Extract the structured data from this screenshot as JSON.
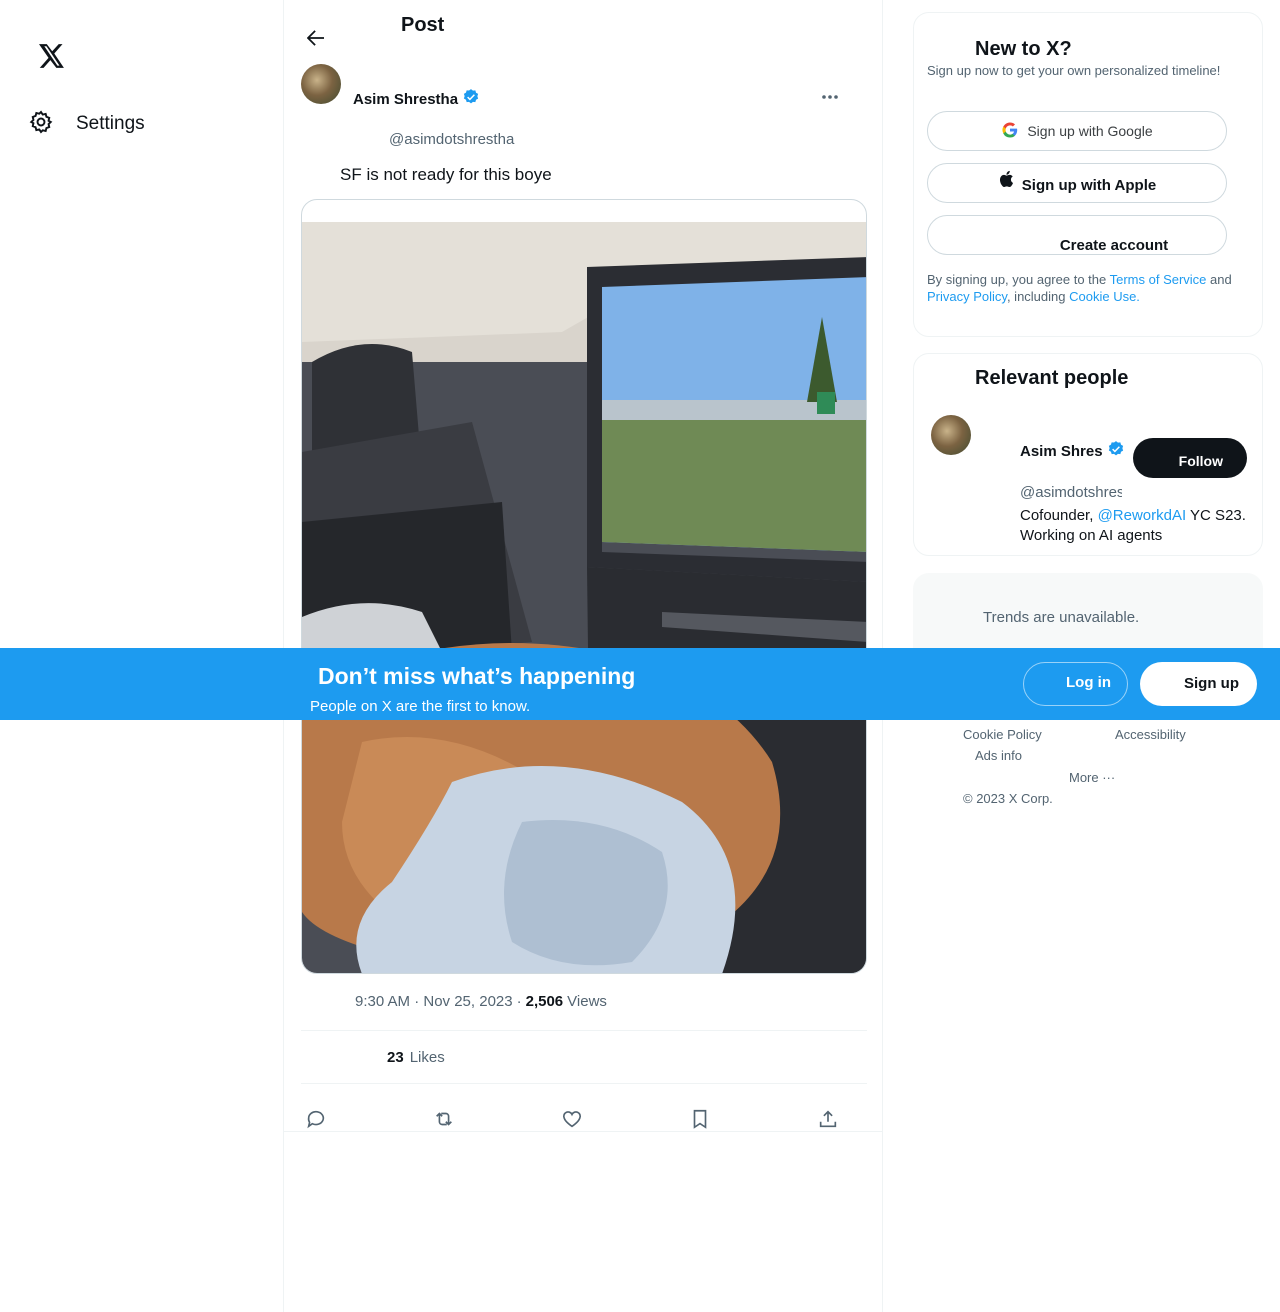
{
  "nav": {
    "logo_icon": "x-logo-icon",
    "settings_label": "Settings"
  },
  "header": {
    "title": "Post"
  },
  "post": {
    "author_name": "Asim Shrestha",
    "author_handle": "@asimdotshrestha",
    "text": "SF is not ready for this boye",
    "time": "9:30 AM · Nov 25, 2023",
    "separator": "·",
    "views_count": "2,506",
    "views_label": "Views",
    "likes_count": "23",
    "likes_label": "Likes"
  },
  "sidebar": {
    "new_title": "New to X?",
    "new_sub": "Sign up now to get your own personalized timeline!",
    "google_label": "Sign up with Google",
    "apple_label": "Sign up with Apple",
    "create_label": "Create account",
    "legal_prefix": "By signing up, you agree to the ",
    "terms": "Terms of Service",
    "and": " and ",
    "privacy": "Privacy Policy",
    "including": ", including ",
    "cookie_use": "Cookie Use.",
    "relevant_title": "Relevant people",
    "rel_name": "Asim Shres",
    "rel_handle": "@asimdotshrestha",
    "follow_label": "Follow",
    "bio_prefix": "Cofounder, ",
    "bio_link": "@ReworkdAI",
    "bio_rest": " YC S23. Working on AI agents",
    "trends_text": "Trends are unavailable.",
    "footer": {
      "cookie_policy": "Cookie Policy",
      "accessibility": "Accessibility",
      "ads_info": "Ads info",
      "more": "More ···",
      "copyright": "© 2023 X Corp."
    }
  },
  "banner": {
    "title": "Don’t miss what’s happening",
    "subtitle": "People on X are the first to know.",
    "login_label": "Log in",
    "signup_label": "Sign up"
  },
  "colors": {
    "brand_blue": "#1d9bf0",
    "text_primary": "#0f1419",
    "text_secondary": "#536471"
  }
}
